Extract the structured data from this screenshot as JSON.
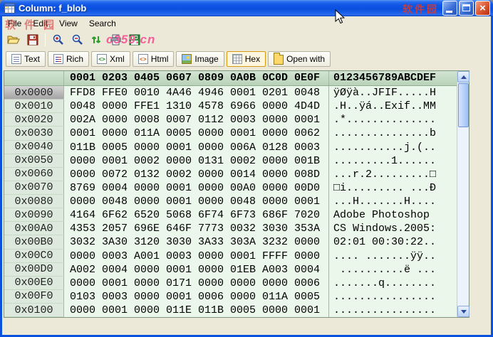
{
  "window": {
    "title": "Column: f_blob"
  },
  "menu": {
    "items": [
      "File",
      "Edit",
      "View",
      "Search"
    ]
  },
  "toolbar": {
    "icons": [
      "open-icon",
      "save-icon",
      "zoom-in-icon",
      "zoom-out-icon",
      "refresh-icon",
      "print-icon",
      "export-icon"
    ]
  },
  "watermark": {
    "title_text": "软件园",
    "menu_text": "软件园",
    "site": "c359.cn"
  },
  "tabs": [
    {
      "label": "Text",
      "icon": "text-icon",
      "selected": false
    },
    {
      "label": "Rich",
      "icon": "rich-icon",
      "selected": false
    },
    {
      "label": "Xml",
      "icon": "xml-icon",
      "selected": false
    },
    {
      "label": "Html",
      "icon": "html-icon",
      "selected": false
    },
    {
      "label": "Image",
      "icon": "image-icon",
      "selected": false
    },
    {
      "label": "Hex",
      "icon": "hex-icon",
      "selected": true
    },
    {
      "label": "Open with",
      "icon": "open-with-icon",
      "selected": false
    }
  ],
  "hex": {
    "header_hex": "0001 0203 0405 0607 0809 0A0B 0C0D 0E0F",
    "header_ascii": "0123456789ABCDEF",
    "rows": [
      {
        "addr": "0x0000",
        "hex": "FFD8 FFE0 0010 4A46 4946 0001 0201 0048",
        "ascii": "ÿØÿà..JFIF.....H",
        "selected": true
      },
      {
        "addr": "0x0010",
        "hex": "0048 0000 FFE1 1310 4578 6966 0000 4D4D",
        "ascii": ".H..ÿá..Exif..MM",
        "selected": false
      },
      {
        "addr": "0x0020",
        "hex": "002A 0000 0008 0007 0112 0003 0000 0001",
        "ascii": ".*..............",
        "selected": false
      },
      {
        "addr": "0x0030",
        "hex": "0001 0000 011A 0005 0000 0001 0000 0062",
        "ascii": "...............b",
        "selected": false
      },
      {
        "addr": "0x0040",
        "hex": "011B 0005 0000 0001 0000 006A 0128 0003",
        "ascii": "...........j.(..",
        "selected": false
      },
      {
        "addr": "0x0050",
        "hex": "0000 0001 0002 0000 0131 0002 0000 001B",
        "ascii": ".........1......",
        "selected": false
      },
      {
        "addr": "0x0060",
        "hex": "0000 0072 0132 0002 0000 0014 0000 008D",
        "ascii": "...r.2.........□",
        "selected": false
      },
      {
        "addr": "0x0070",
        "hex": "8769 0004 0000 0001 0000 00A0 0000 00D0",
        "ascii": "□i......... ...Ð",
        "selected": false
      },
      {
        "addr": "0x0080",
        "hex": "0000 0048 0000 0001 0000 0048 0000 0001",
        "ascii": "...H.......H....",
        "selected": false
      },
      {
        "addr": "0x0090",
        "hex": "4164 6F62 6520 5068 6F74 6F73 686F 7020",
        "ascii": "Adobe Photoshop ",
        "selected": false
      },
      {
        "addr": "0x00A0",
        "hex": "4353 2057 696E 646F 7773 0032 3030 353A",
        "ascii": "CS Windows.2005:",
        "selected": false
      },
      {
        "addr": "0x00B0",
        "hex": "3032 3A30 3120 3030 3A33 303A 3232 0000",
        "ascii": "02:01 00:30:22..",
        "selected": false
      },
      {
        "addr": "0x00C0",
        "hex": "0000 0003 A001 0003 0000 0001 FFFF 0000",
        "ascii": ".... .......ÿÿ..",
        "selected": false
      },
      {
        "addr": "0x00D0",
        "hex": "A002 0004 0000 0001 0000 01EB A003 0004",
        "ascii": " ..........ë ...",
        "selected": false
      },
      {
        "addr": "0x00E0",
        "hex": "0000 0001 0000 0171 0000 0000 0000 0006",
        "ascii": ".......q........",
        "selected": false
      },
      {
        "addr": "0x00F0",
        "hex": "0103 0003 0000 0001 0006 0000 011A 0005",
        "ascii": "................",
        "selected": false
      },
      {
        "addr": "0x0100",
        "hex": "0000 0001 0000 011E 011B 0005 0000 0001",
        "ascii": "................",
        "selected": false
      }
    ]
  }
}
